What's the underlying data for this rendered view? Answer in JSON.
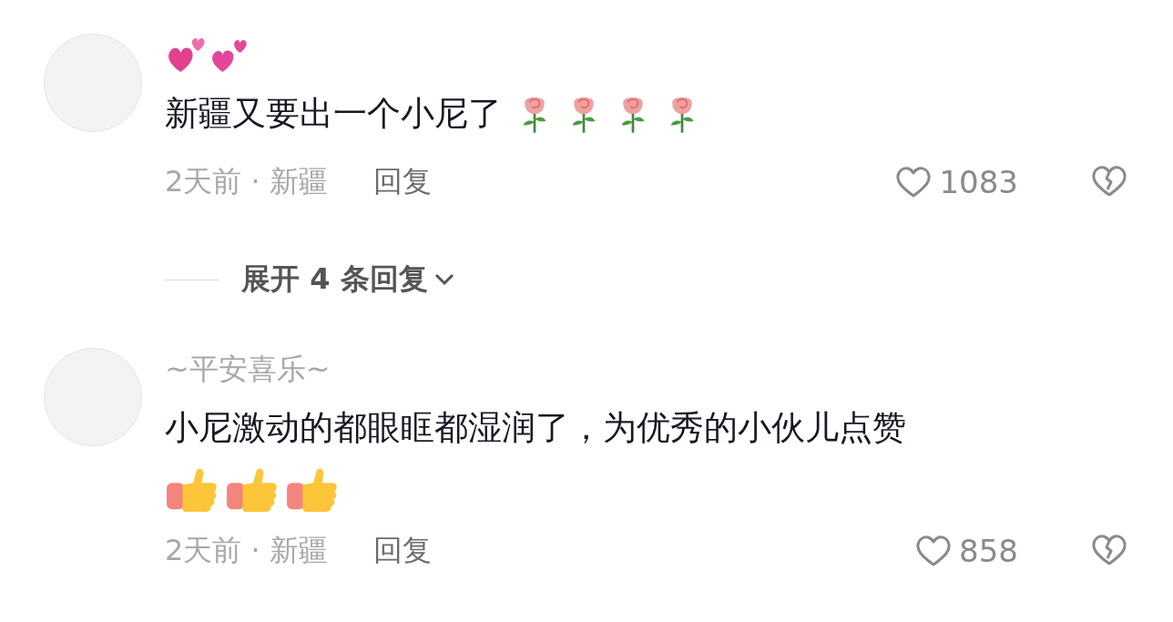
{
  "comments": [
    {
      "name_emoji": [
        {
          "kind": "revolving-hearts"
        },
        {
          "kind": "two-hearts"
        }
      ],
      "text": "新疆又要出一个小尼了",
      "text_emoji": [
        {
          "kind": "rose"
        },
        {
          "kind": "rose"
        },
        {
          "kind": "rose"
        },
        {
          "kind": "rose"
        }
      ],
      "meta": "2天前 · 新疆",
      "reply": "回复",
      "likes": "1083",
      "expand": "展开 4 条回复"
    },
    {
      "name": "~平安喜乐~",
      "text": "小尼激动的都眼眶都湿润了，为优秀的小伙儿点赞",
      "emoji_line": [
        {
          "kind": "thumbs-up"
        },
        {
          "kind": "thumbs-up"
        },
        {
          "kind": "thumbs-up"
        }
      ],
      "meta": "2天前 · 新疆",
      "reply": "回复",
      "likes": "858"
    }
  ]
}
